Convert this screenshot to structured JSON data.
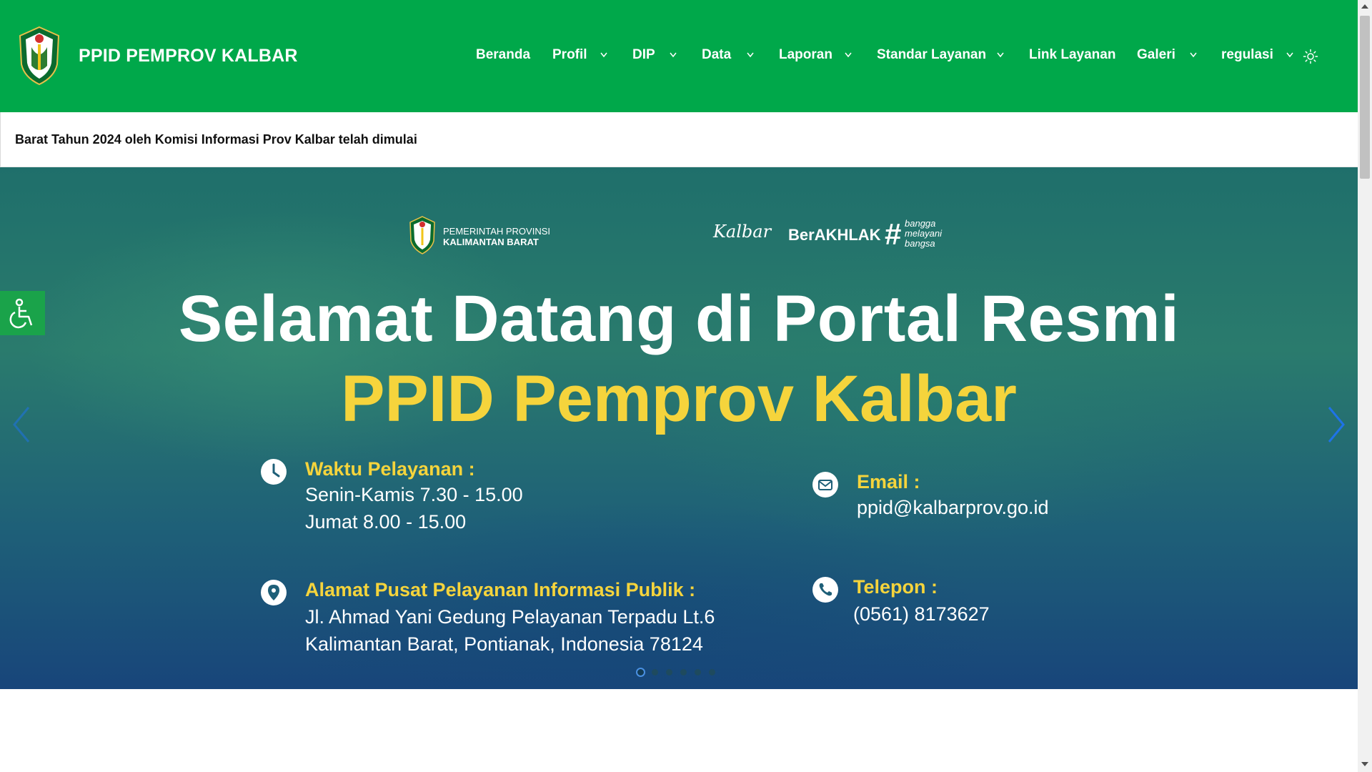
{
  "header": {
    "site_title": "PPID PEMPROV KALBAR",
    "nav": [
      {
        "label": "Beranda",
        "has_dropdown": false
      },
      {
        "label": "Profil",
        "has_dropdown": true
      },
      {
        "label": "DIP",
        "has_dropdown": true
      },
      {
        "label": "Data",
        "has_dropdown": true
      },
      {
        "label": "Laporan",
        "has_dropdown": true
      },
      {
        "label": "Standar Layanan",
        "has_dropdown": true
      },
      {
        "label": "Link Layanan",
        "has_dropdown": false
      },
      {
        "label": "Galeri",
        "has_dropdown": true
      },
      {
        "label": "regulasi",
        "has_dropdown": true
      }
    ],
    "theme_toggle_icon": "sun-icon"
  },
  "ticker": {
    "text": "Barat Tahun 2024 oleh Komisi Informasi Prov Kalbar telah dimulai"
  },
  "hero": {
    "gov_name_line1": "PEMERINTAH PROVINSI",
    "gov_name_line2": "KALIMANTAN BARAT",
    "brand_kalbar": "Kalbar",
    "brand_berakhlak": "BerAKHLAK",
    "brand_bangga_hash": "#",
    "brand_bangga_text": "bangga melayani bangsa",
    "title": "Selamat Datang di Portal Resmi",
    "subtitle": "PPID Pemprov Kalbar",
    "hours": {
      "heading": "Waktu Pelayanan :",
      "line1": "Senin-Kamis 7.30 - 15.00",
      "line2": "Jumat 8.00 - 15.00"
    },
    "email": {
      "heading": "Email :",
      "value": "ppid@kalbarprov.go.id"
    },
    "address": {
      "heading": "Alamat Pusat Pelayanan Informasi Publik :",
      "line1": "Jl. Ahmad Yani Gedung Pelayanan Terpadu Lt.6",
      "line2": "Kalimantan Barat, Pontianak, Indonesia 78124"
    },
    "phone": {
      "heading": "Telepon :",
      "value": "(0561) 8173627"
    },
    "slide_count": 6,
    "active_slide": 1
  },
  "colors": {
    "header_green": "#00a84a",
    "accent_yellow": "#f5d43c",
    "arrow_blue": "#1e73e8"
  }
}
